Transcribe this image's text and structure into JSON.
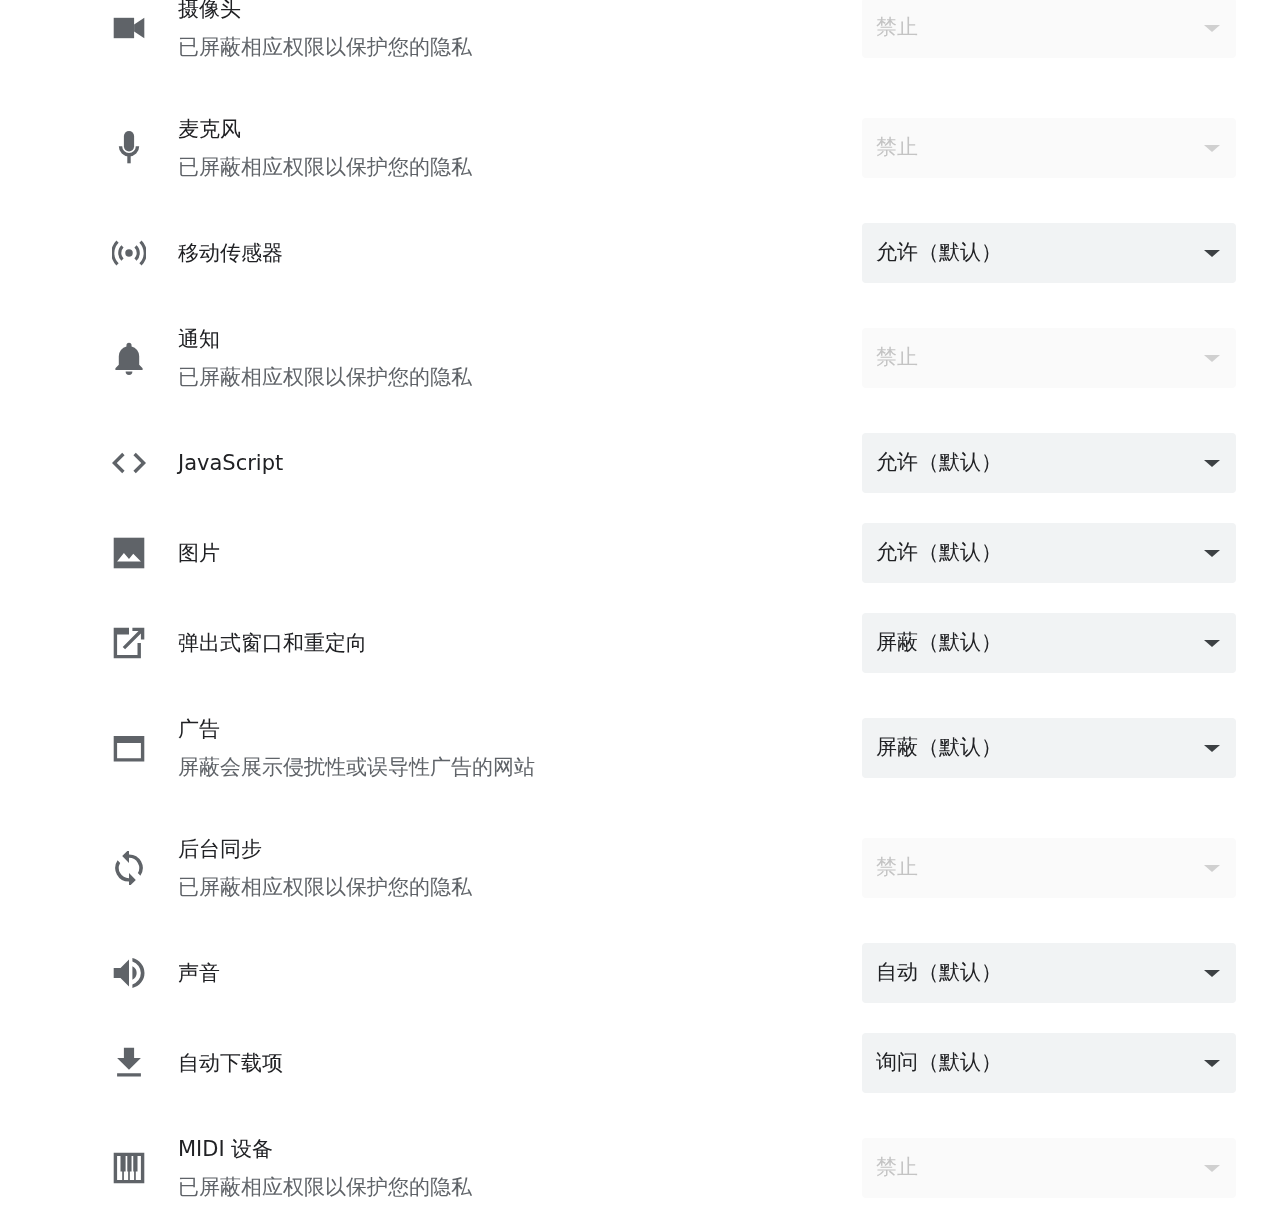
{
  "permissions": [
    {
      "title": "摄像头",
      "subtitle": "已屏蔽相应权限以保护您的隐私",
      "value": "禁止",
      "disabled": true
    },
    {
      "title": "麦克风",
      "subtitle": "已屏蔽相应权限以保护您的隐私",
      "value": "禁止",
      "disabled": true
    },
    {
      "title": "移动传感器",
      "value": "允许（默认）",
      "disabled": false
    },
    {
      "title": "通知",
      "subtitle": "已屏蔽相应权限以保护您的隐私",
      "value": "禁止",
      "disabled": true
    },
    {
      "title": "JavaScript",
      "value": "允许（默认）",
      "disabled": false
    },
    {
      "title": "图片",
      "value": "允许（默认）",
      "disabled": false
    },
    {
      "title": "弹出式窗口和重定向",
      "value": "屏蔽（默认）",
      "disabled": false
    },
    {
      "title": "广告",
      "subtitle": "屏蔽会展示侵扰性或误导性广告的网站",
      "value": "屏蔽（默认）",
      "disabled": false
    },
    {
      "title": "后台同步",
      "subtitle": "已屏蔽相应权限以保护您的隐私",
      "value": "禁止",
      "disabled": true
    },
    {
      "title": "声音",
      "value": "自动（默认）",
      "disabled": false
    },
    {
      "title": "自动下载项",
      "value": "询问（默认）",
      "disabled": false
    },
    {
      "title": "MIDI 设备",
      "subtitle": "已屏蔽相应权限以保护您的隐私",
      "value": "禁止",
      "disabled": true
    }
  ]
}
